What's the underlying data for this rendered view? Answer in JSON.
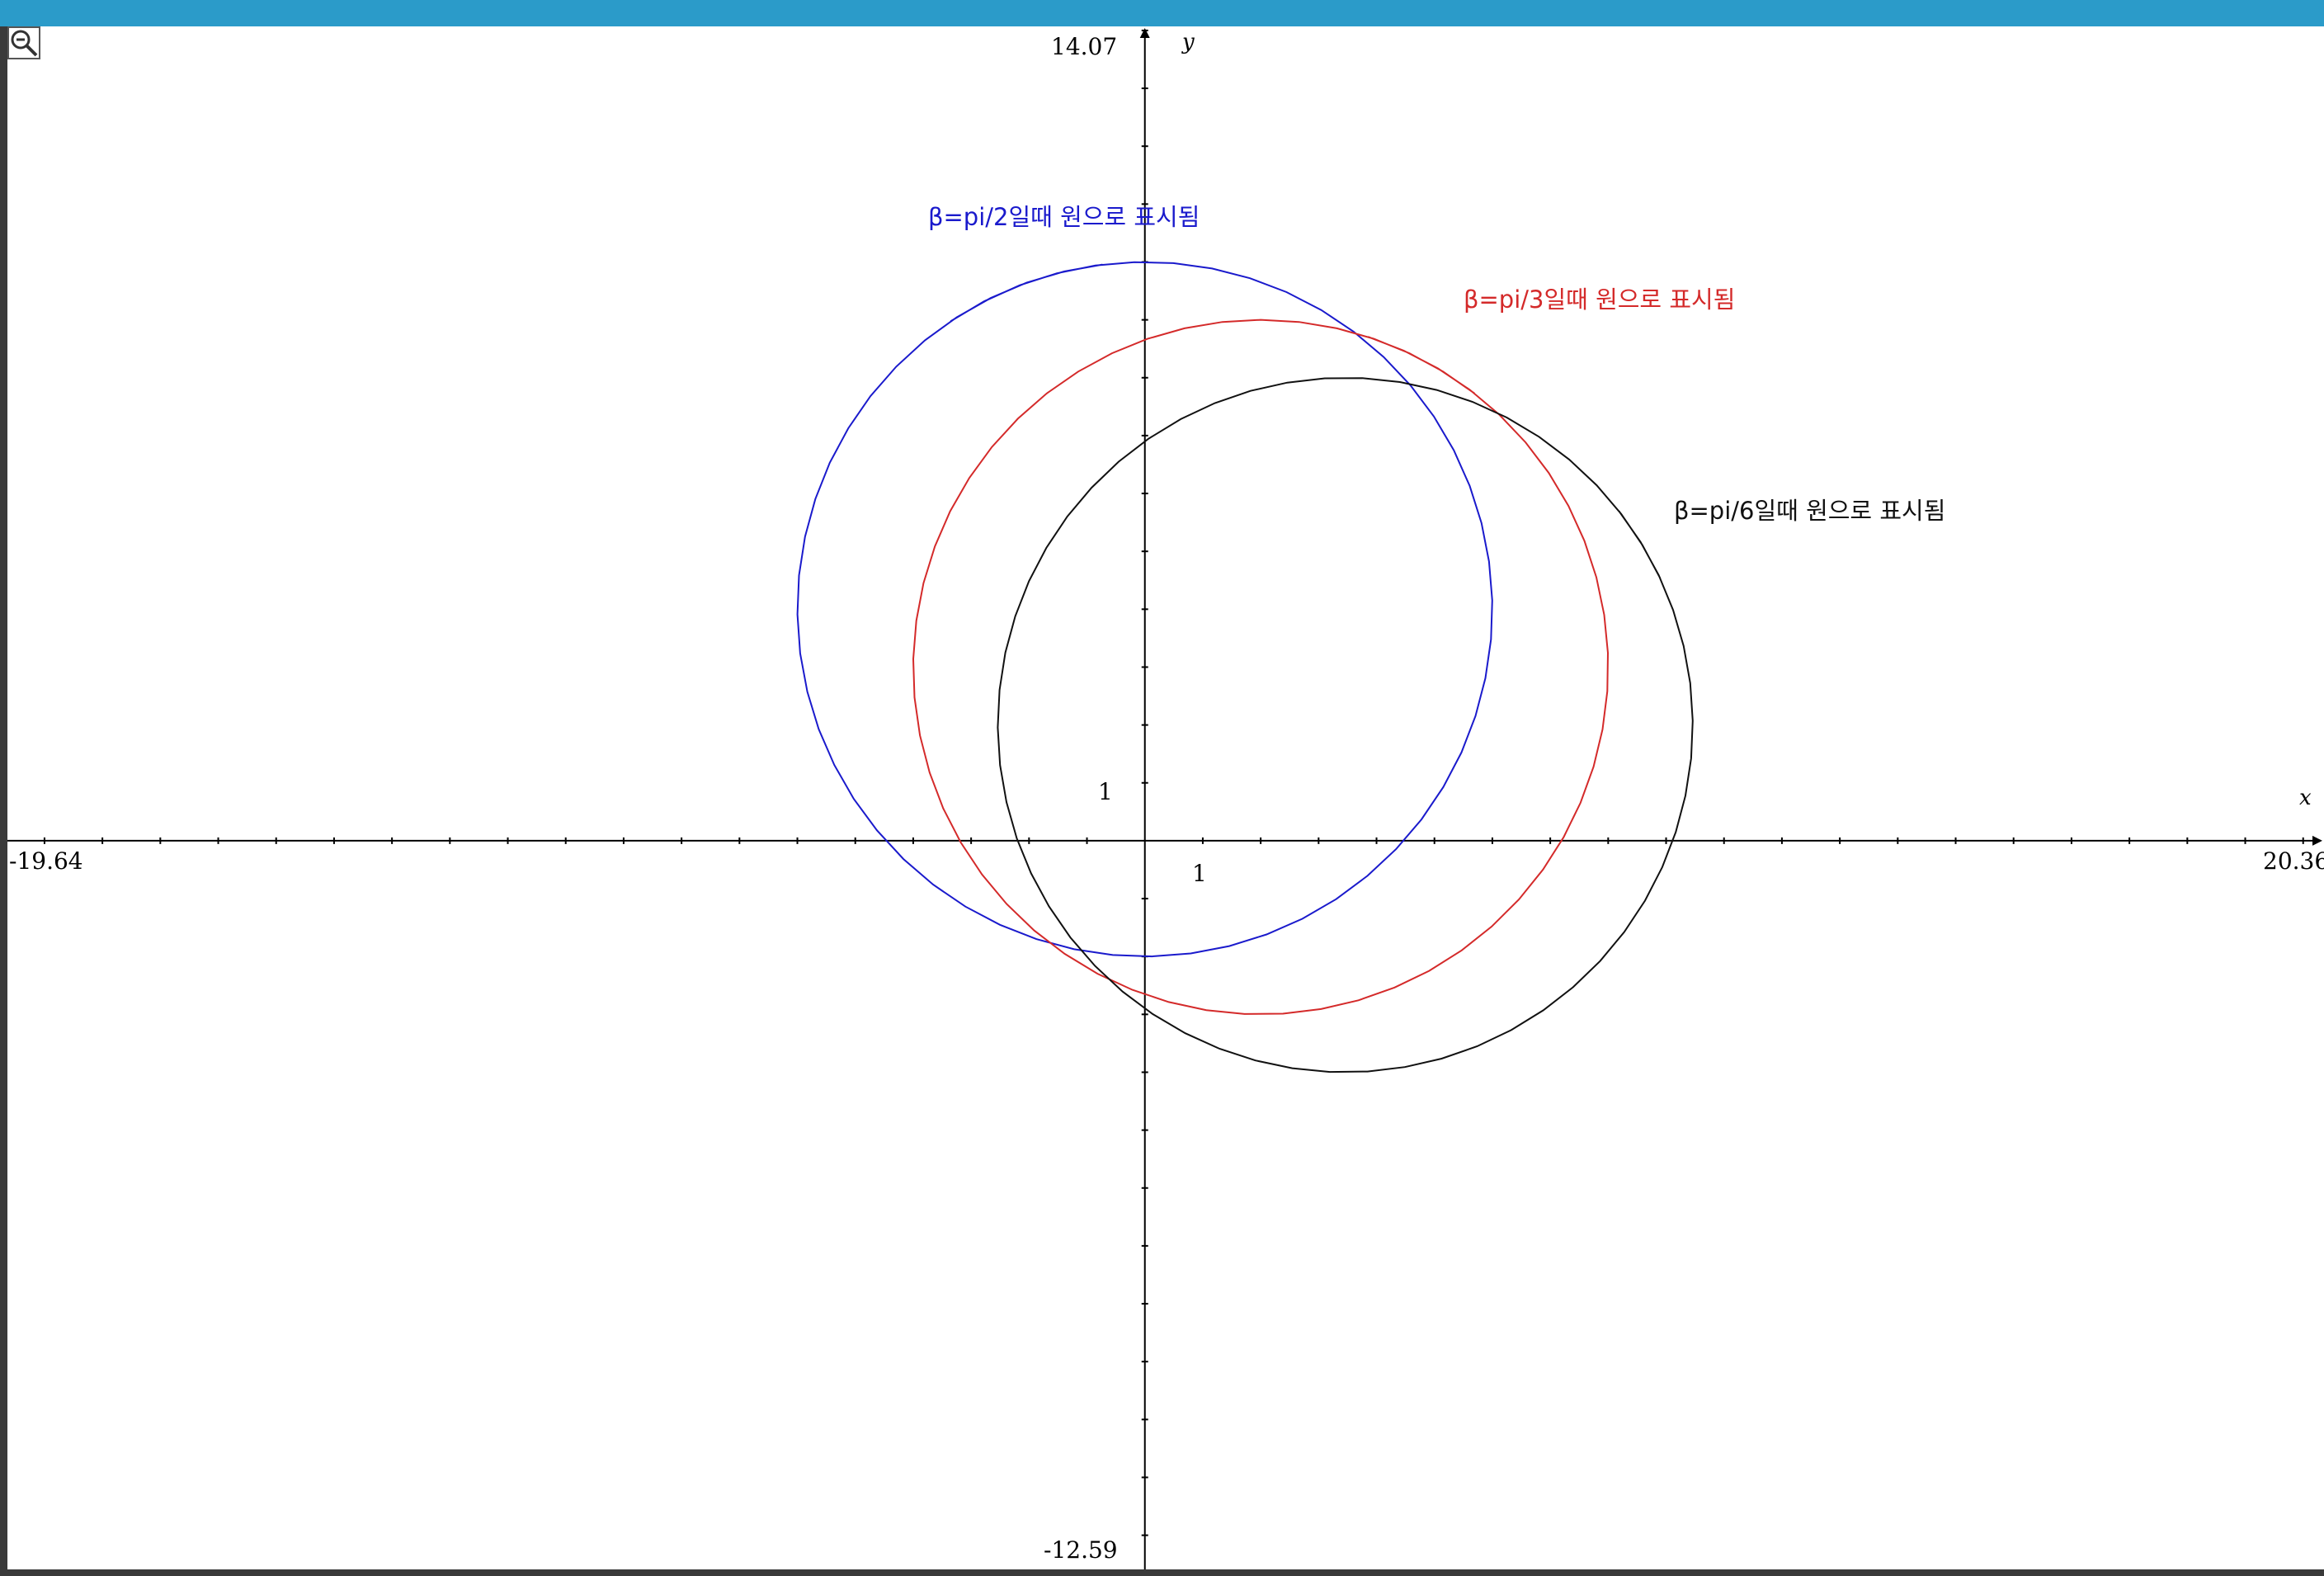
{
  "chart_data": {
    "type": "line",
    "x_axis": {
      "name": "x",
      "min": -19.64,
      "max": 20.36,
      "min_label": "-19.64",
      "max_label": "20.36",
      "unit_label": "1"
    },
    "y_axis": {
      "name": "y",
      "min": -12.59,
      "max": 14.07,
      "min_label": "-12.59",
      "max_label": "14.07",
      "unit_label": "1"
    },
    "grid": false,
    "series": [
      {
        "label": "β=pi/2일때 원으로 표시됨",
        "color": "#1a1acc",
        "center": [
          0,
          4
        ],
        "radius": 6,
        "theta_start_deg": 97,
        "theta_end_deg": 484
      },
      {
        "label": "β=pi/3일때 원으로 표시됨",
        "color": "#d42a2a",
        "center": [
          2,
          3
        ],
        "radius": 6,
        "theta_start_deg": 52,
        "theta_end_deg": 432
      },
      {
        "label": "β=pi/6일때 원으로 표시됨",
        "color": "#111111",
        "center": [
          3.46,
          2
        ],
        "radius": 6,
        "theta_start_deg": 25,
        "theta_end_deg": 398
      }
    ]
  },
  "toolbar": {
    "zoom_icon": "zoom-out-icon"
  }
}
